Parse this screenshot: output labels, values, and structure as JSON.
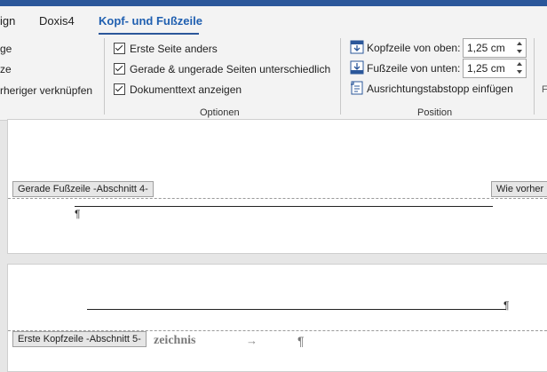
{
  "tabs": [
    {
      "label": "ign"
    },
    {
      "label": "Doxis4"
    },
    {
      "label": "Kopf- und Fußzeile"
    }
  ],
  "navigation_group": {
    "items": [
      {
        "label": "ge"
      },
      {
        "label": "ze"
      },
      {
        "label": "rheriger verknüpfen"
      }
    ]
  },
  "options_group": {
    "label": "Optionen",
    "checkboxes": [
      {
        "label": "Erste Seite anders",
        "checked": true
      },
      {
        "label": "Gerade & ungerade Seiten unterschiedlich",
        "checked": true
      },
      {
        "label": "Dokumenttext anzeigen",
        "checked": true
      }
    ]
  },
  "position_group": {
    "label": "Position",
    "header_from_top": {
      "label": "Kopfzeile von oben:",
      "value": "1,25 cm"
    },
    "footer_from_bottom": {
      "label": "Fußzeile von unten:",
      "value": "1,25 cm"
    },
    "insert_alignment_tab": {
      "label": "Ausrichtungstabstopp einfügen"
    }
  },
  "document": {
    "footer_tag": "Gerade Fußzeile -Abschnitt 4-",
    "same_as_previous_tag": "Wie vorher",
    "header_tag": "Erste Kopfzeile -Abschnitt 5-",
    "visible_text": "zeichnis",
    "pilcrow": "¶",
    "arrow": "→"
  },
  "colors": {
    "accent": "#2b579a",
    "active_tab": "#1f5fb0"
  }
}
